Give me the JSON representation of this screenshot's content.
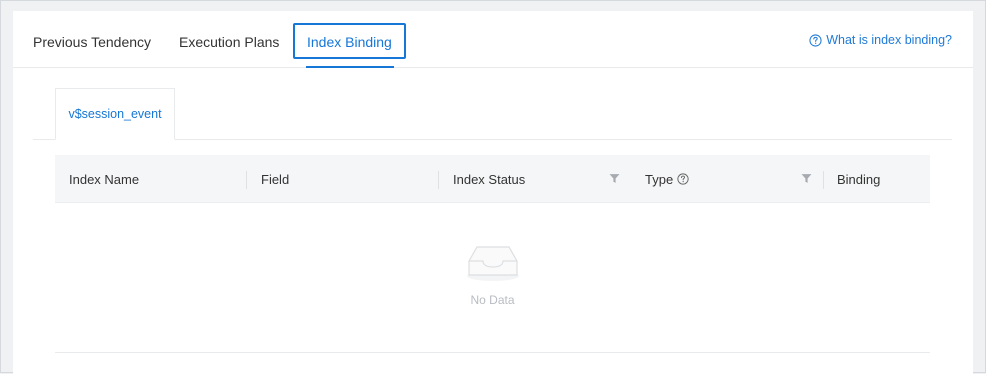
{
  "tabs": {
    "previous": "Previous Tendency",
    "execution": "Execution Plans",
    "binding": "Index Binding"
  },
  "help": {
    "label": "What is index binding?"
  },
  "subtab": {
    "label": "v$session_event"
  },
  "table": {
    "columns": [
      "Index Name",
      "Field",
      "Index Status",
      "Type",
      "Binding"
    ],
    "empty_text": "No Data"
  },
  "colors": {
    "accent": "#1677d6",
    "muted": "#b8bcc2"
  },
  "icons": [
    "help-circle-icon",
    "filter-icon",
    "question-icon",
    "empty-inbox-icon"
  ]
}
